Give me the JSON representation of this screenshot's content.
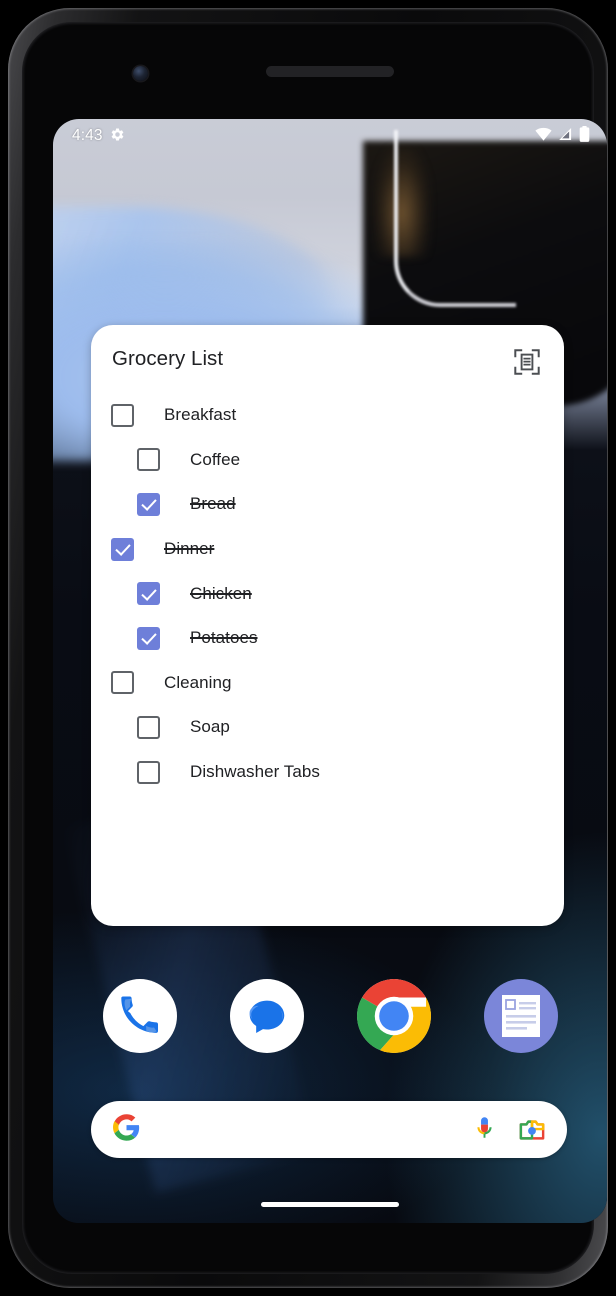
{
  "device": {
    "name": "android-phone",
    "front_camera": "front-camera",
    "earpiece": "earpiece-speaker"
  },
  "status_bar": {
    "clock": "4:43",
    "icons_left": [
      "settings-gear-icon"
    ],
    "icons_right": [
      "wifi-icon",
      "cell-signal-icon",
      "battery-icon"
    ]
  },
  "widget": {
    "title": "Grocery List",
    "scan_icon": "document-scan-icon",
    "items": [
      {
        "label": "Breakfast",
        "checked": false,
        "indent": 0
      },
      {
        "label": "Coffee",
        "checked": false,
        "indent": 1
      },
      {
        "label": "Bread",
        "checked": true,
        "indent": 1
      },
      {
        "label": "Dinner",
        "checked": true,
        "indent": 0
      },
      {
        "label": "Chicken",
        "checked": true,
        "indent": 1
      },
      {
        "label": "Potatoes",
        "checked": true,
        "indent": 1
      },
      {
        "label": "Cleaning",
        "checked": false,
        "indent": 0
      },
      {
        "label": "Soap",
        "checked": false,
        "indent": 1
      },
      {
        "label": "Dishwasher Tabs",
        "checked": false,
        "indent": 1
      }
    ],
    "checked_color": "#6e7fd9",
    "unchecked_border_color": "#5f6368",
    "text_color": "#202124",
    "background": "#ffffff"
  },
  "dock": {
    "apps": [
      {
        "name": "phone-app-icon",
        "label": "Phone"
      },
      {
        "name": "messages-app-icon",
        "label": "Messages"
      },
      {
        "name": "chrome-app-icon",
        "label": "Chrome"
      },
      {
        "name": "news-app-icon",
        "label": "News"
      }
    ]
  },
  "search": {
    "logo": "google-g-logo",
    "value": "",
    "placeholder": "",
    "mic_icon": "microphone-icon",
    "lens_icon": "google-lens-camera-icon"
  },
  "navigation": {
    "home_indicator": "home-gesture-bar"
  },
  "colors": {
    "google_blue": "#4285F4",
    "google_red": "#EA4335",
    "google_yellow": "#FBBC05",
    "google_green": "#34A853",
    "accent_periwinkle": "#6e7fd9",
    "news_app_bg": "#7b86d9"
  }
}
